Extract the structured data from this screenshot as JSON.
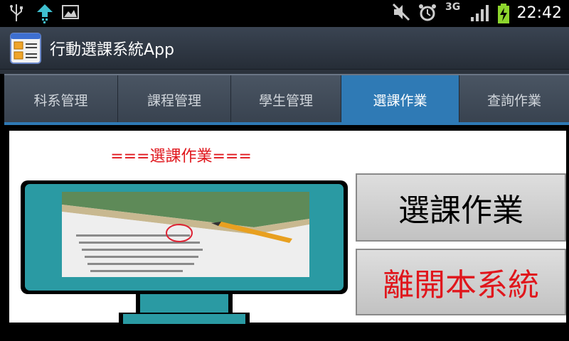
{
  "status_bar": {
    "time": "22:42",
    "network": "3G",
    "icons": [
      "usb-icon",
      "upload-icon",
      "image-icon",
      "mute-icon",
      "alarm-icon",
      "network-3g-icon",
      "signal-icon",
      "battery-charging-icon"
    ]
  },
  "app": {
    "title": "行動選課系統App",
    "icon": "app-list-icon"
  },
  "tabs": [
    {
      "label": "科系管理",
      "active": false
    },
    {
      "label": "課程管理",
      "active": false
    },
    {
      "label": "學生管理",
      "active": false
    },
    {
      "label": "選課作業",
      "active": true
    },
    {
      "label": "查詢作業",
      "active": false
    }
  ],
  "main": {
    "heading": "===選課作業===",
    "image_alt": "computer-monitor-exam-illustration",
    "buttons": {
      "enroll": "選課作業",
      "exit": "離開本系統"
    }
  },
  "colors": {
    "accent": "#2f7ab5",
    "heading_red": "#e0161c",
    "monitor_teal": "#2a9aa3"
  }
}
